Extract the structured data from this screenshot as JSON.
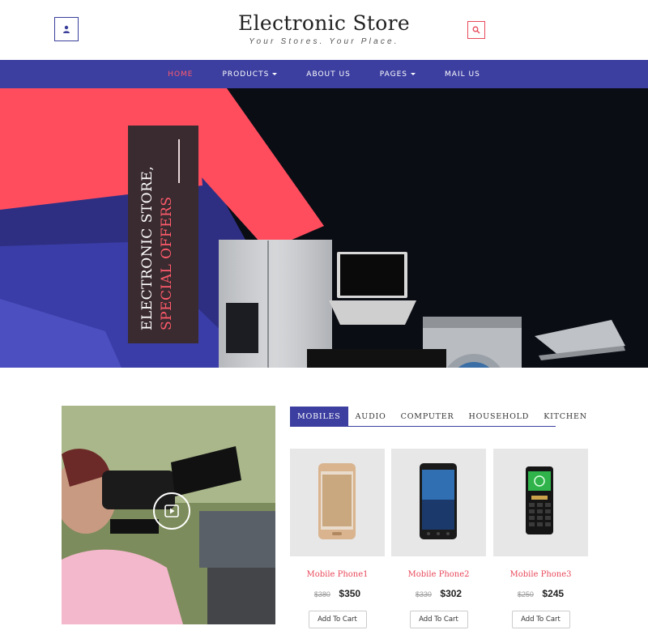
{
  "header": {
    "brand_title": "Electronic Store",
    "brand_tagline": "Your Stores. Your Place."
  },
  "nav": {
    "items": [
      {
        "label": "HOME",
        "active": true,
        "dropdown": false
      },
      {
        "label": "PRODUCTS",
        "active": false,
        "dropdown": true
      },
      {
        "label": "ABOUT US",
        "active": false,
        "dropdown": false
      },
      {
        "label": "PAGES",
        "active": false,
        "dropdown": true
      },
      {
        "label": "MAIL US",
        "active": false,
        "dropdown": false
      }
    ]
  },
  "hero": {
    "promo_line1": "ELECTRONIC STORE,",
    "promo_line2": "SPECIAL OFFERS"
  },
  "tabs": [
    {
      "label": "MOBILES",
      "active": true
    },
    {
      "label": "AUDIO",
      "active": false
    },
    {
      "label": "COMPUTER",
      "active": false
    },
    {
      "label": "HOUSEHOLD",
      "active": false
    },
    {
      "label": "KITCHEN",
      "active": false
    }
  ],
  "products": [
    {
      "name": "Mobile Phone1",
      "old_price": "$380",
      "price": "$350",
      "button": "Add To Cart"
    },
    {
      "name": "Mobile Phone2",
      "old_price": "$330",
      "price": "$302",
      "button": "Add To Cart"
    },
    {
      "name": "Mobile Phone3",
      "old_price": "$250",
      "price": "$245",
      "button": "Add To Cart"
    }
  ],
  "colors": {
    "nav_bg": "#3c3fa0",
    "accent_red": "#ff5a6b",
    "card_bg": "#e7e7e7"
  },
  "icons": {
    "user": "user-icon",
    "search": "search-icon",
    "play": "play-icon"
  }
}
